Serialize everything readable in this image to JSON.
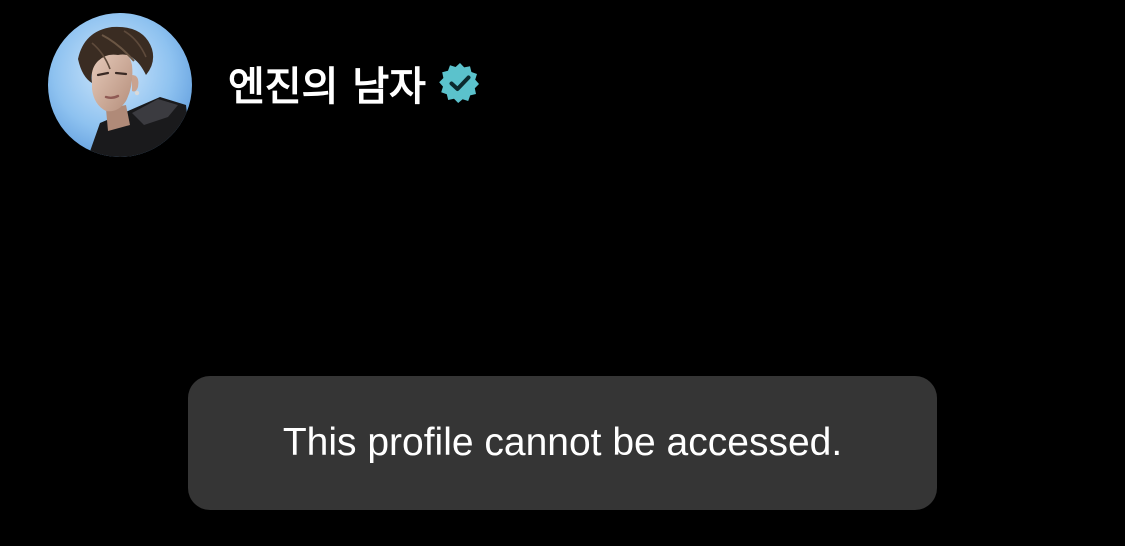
{
  "profile": {
    "display_name": "엔진의 남자",
    "verified": true,
    "avatar_icon": "profile-photo",
    "verified_icon": "verified-badge-icon"
  },
  "toast": {
    "message": "This profile cannot be accessed."
  },
  "colors": {
    "background": "#000000",
    "toast_background": "#353535",
    "verified_badge": "#5BC2CC",
    "text": "#FFFFFF"
  }
}
